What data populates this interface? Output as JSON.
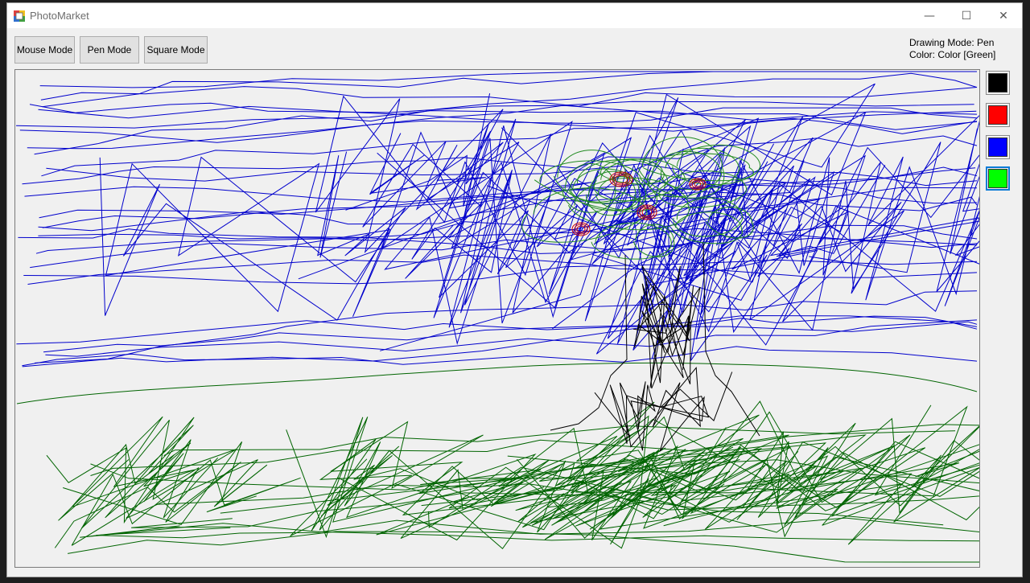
{
  "window": {
    "title": "PhotoMarket",
    "controls": {
      "minimize": "—",
      "maximize": "☐",
      "close": "✕"
    }
  },
  "toolbar": {
    "mouse_mode": "Mouse Mode",
    "pen_mode": "Pen Mode",
    "square_mode": "Square Mode"
  },
  "status": {
    "drawing_mode": "Drawing Mode: Pen",
    "color": "Color: Color [Green]"
  },
  "palette": {
    "swatches": [
      {
        "name": "Black",
        "hex": "#000000"
      },
      {
        "name": "Red",
        "hex": "#ff0000"
      },
      {
        "name": "Blue",
        "hex": "#0000ff"
      },
      {
        "name": "Green",
        "hex": "#00ff00"
      }
    ],
    "selected": "Green"
  },
  "stroke_colors": {
    "sky": "#0000cc",
    "grass": "#006400",
    "leaves": "#228b22",
    "trunk": "#000000",
    "apples": "#cc0000"
  }
}
